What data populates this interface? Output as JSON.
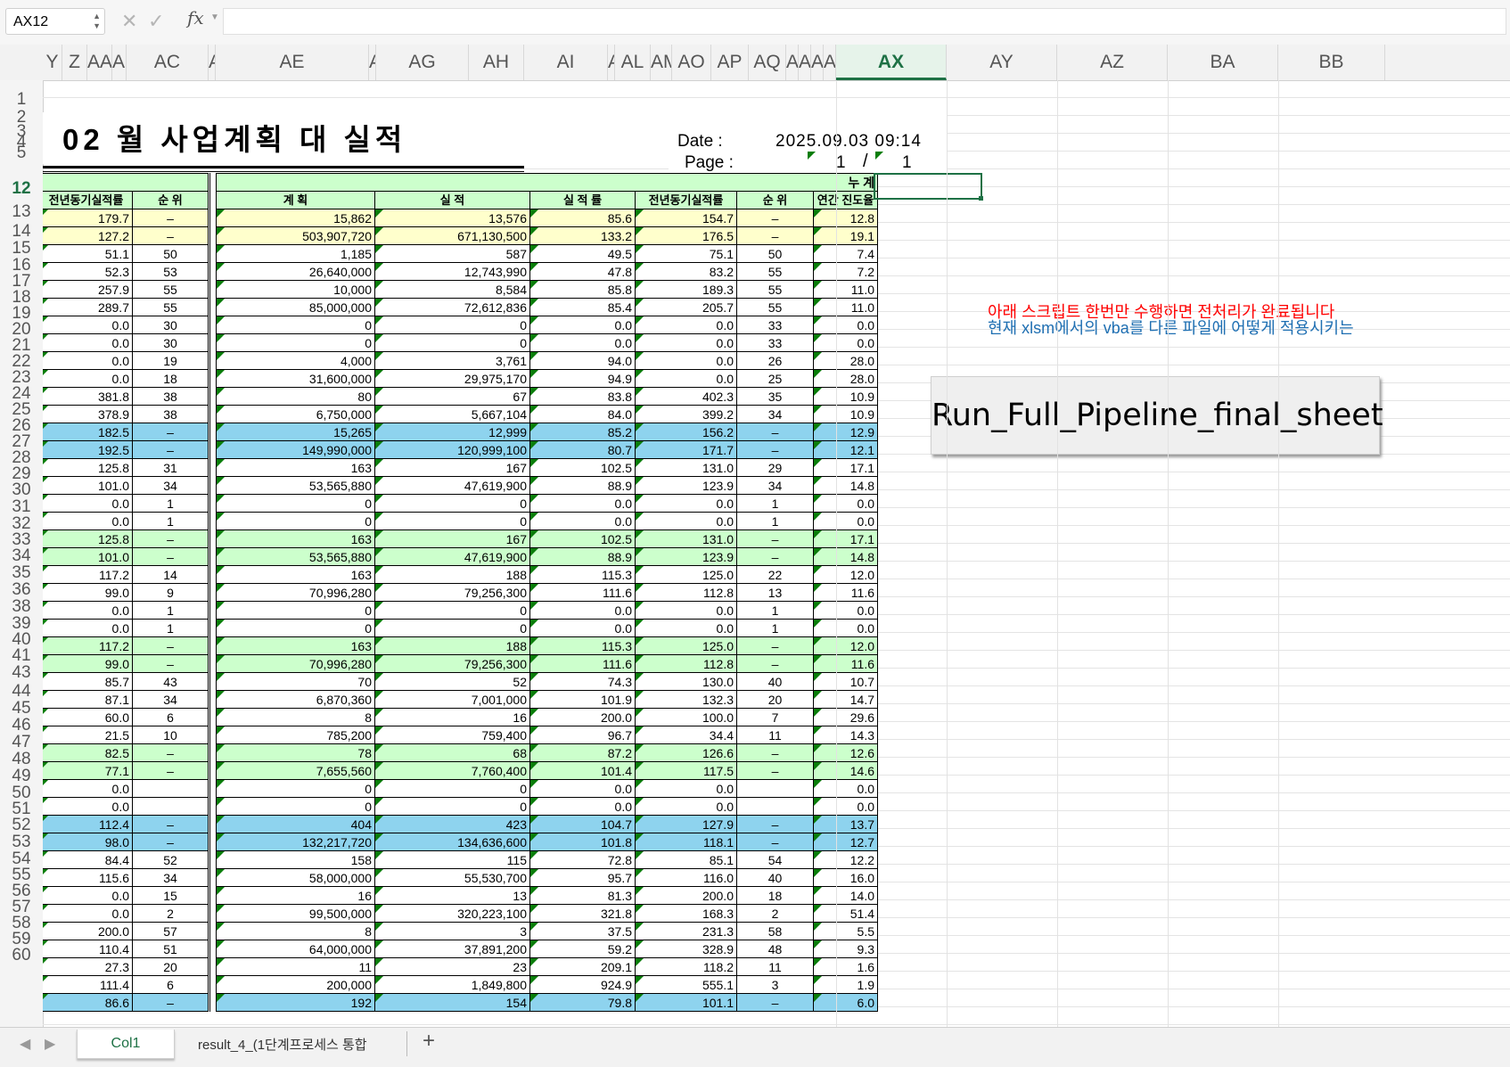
{
  "formula_bar": {
    "name_box": "AX12",
    "fx": "fx",
    "cancel": "✕",
    "confirm": "✓"
  },
  "columns": [
    "Y",
    "Z",
    "AA",
    "AI",
    "AC",
    "A",
    "AE",
    "A",
    "AG",
    "AH",
    "AI",
    "A",
    "AL",
    "AM",
    "AO",
    "AP",
    "AQ",
    "AR",
    "AS",
    "AT",
    "AU",
    "AX",
    "AY",
    "AZ",
    "BA",
    "BB"
  ],
  "selected_column": "AX",
  "rows": [
    "1",
    "2",
    "3",
    "4",
    "5",
    "12",
    "13",
    "14",
    "15",
    "16",
    "17",
    "18",
    "19",
    "20",
    "21",
    "22",
    "23",
    "24",
    "25",
    "26",
    "27",
    "28",
    "29",
    "30",
    "31",
    "32",
    "33",
    "34",
    "35",
    "36",
    "38",
    "39",
    "40",
    "41",
    "43",
    "44",
    "45",
    "46",
    "47",
    "48",
    "49",
    "50",
    "51",
    "52",
    "53",
    "54",
    "55",
    "56",
    "57",
    "58",
    "59",
    "60"
  ],
  "selected_row": "12",
  "sheet": {
    "title": "02 월  사업계획 대 실적",
    "date_label": "Date :",
    "date_value": "2025.09.03 09:14",
    "page_label": "Page :",
    "page_current": "1",
    "page_sep": "/",
    "page_total": "1"
  },
  "table": {
    "group_header": "누        계",
    "headers": [
      "전년동기실적률",
      "순 위",
      "계    획",
      "실    적",
      "실 적 률",
      "전년동기실적률",
      "순 위",
      "연간 진도율"
    ],
    "rows": [
      {
        "s": "y",
        "v": [
          "179.7",
          "–",
          "15,862",
          "13,576",
          "85.6",
          "154.7",
          "–",
          "12.8"
        ]
      },
      {
        "s": "y",
        "v": [
          "127.2",
          "–",
          "503,907,720",
          "671,130,500",
          "133.2",
          "176.5",
          "–",
          "19.1"
        ]
      },
      {
        "s": "",
        "v": [
          "51.1",
          "50",
          "1,185",
          "587",
          "49.5",
          "75.1",
          "50",
          "7.4"
        ]
      },
      {
        "s": "",
        "v": [
          "52.3",
          "53",
          "26,640,000",
          "12,743,990",
          "47.8",
          "83.2",
          "55",
          "7.2"
        ]
      },
      {
        "s": "",
        "v": [
          "257.9",
          "55",
          "10,000",
          "8,584",
          "85.8",
          "189.3",
          "55",
          "11.0"
        ]
      },
      {
        "s": "",
        "v": [
          "289.7",
          "55",
          "85,000,000",
          "72,612,836",
          "85.4",
          "205.7",
          "55",
          "11.0"
        ]
      },
      {
        "s": "",
        "v": [
          "0.0",
          "30",
          "0",
          "0",
          "0.0",
          "0.0",
          "33",
          "0.0"
        ]
      },
      {
        "s": "",
        "v": [
          "0.0",
          "30",
          "0",
          "0",
          "0.0",
          "0.0",
          "33",
          "0.0"
        ]
      },
      {
        "s": "",
        "v": [
          "0.0",
          "19",
          "4,000",
          "3,761",
          "94.0",
          "0.0",
          "26",
          "28.0"
        ]
      },
      {
        "s": "",
        "v": [
          "0.0",
          "18",
          "31,600,000",
          "29,975,170",
          "94.9",
          "0.0",
          "25",
          "28.0"
        ]
      },
      {
        "s": "",
        "v": [
          "381.8",
          "38",
          "80",
          "67",
          "83.8",
          "402.3",
          "35",
          "10.9"
        ]
      },
      {
        "s": "",
        "v": [
          "378.9",
          "38",
          "6,750,000",
          "5,667,104",
          "84.0",
          "399.2",
          "34",
          "10.9"
        ]
      },
      {
        "s": "b",
        "v": [
          "182.5",
          "–",
          "15,265",
          "12,999",
          "85.2",
          "156.2",
          "–",
          "12.9"
        ]
      },
      {
        "s": "b",
        "v": [
          "192.5",
          "–",
          "149,990,000",
          "120,999,100",
          "80.7",
          "171.7",
          "–",
          "12.1"
        ]
      },
      {
        "s": "",
        "v": [
          "125.8",
          "31",
          "163",
          "167",
          "102.5",
          "131.0",
          "29",
          "17.1"
        ]
      },
      {
        "s": "",
        "v": [
          "101.0",
          "34",
          "53,565,880",
          "47,619,900",
          "88.9",
          "123.9",
          "34",
          "14.8"
        ]
      },
      {
        "s": "",
        "v": [
          "0.0",
          "1",
          "0",
          "0",
          "0.0",
          "0.0",
          "1",
          "0.0"
        ]
      },
      {
        "s": "",
        "v": [
          "0.0",
          "1",
          "0",
          "0",
          "0.0",
          "0.0",
          "1",
          "0.0"
        ]
      },
      {
        "s": "g",
        "v": [
          "125.8",
          "–",
          "163",
          "167",
          "102.5",
          "131.0",
          "–",
          "17.1"
        ]
      },
      {
        "s": "g",
        "v": [
          "101.0",
          "–",
          "53,565,880",
          "47,619,900",
          "88.9",
          "123.9",
          "–",
          "14.8"
        ]
      },
      {
        "s": "",
        "v": [
          "117.2",
          "14",
          "163",
          "188",
          "115.3",
          "125.0",
          "22",
          "12.0"
        ]
      },
      {
        "s": "",
        "v": [
          "99.0",
          "9",
          "70,996,280",
          "79,256,300",
          "111.6",
          "112.8",
          "13",
          "11.6"
        ]
      },
      {
        "s": "",
        "v": [
          "0.0",
          "1",
          "0",
          "0",
          "0.0",
          "0.0",
          "1",
          "0.0"
        ]
      },
      {
        "s": "",
        "v": [
          "0.0",
          "1",
          "0",
          "0",
          "0.0",
          "0.0",
          "1",
          "0.0"
        ]
      },
      {
        "s": "g",
        "v": [
          "117.2",
          "–",
          "163",
          "188",
          "115.3",
          "125.0",
          "–",
          "12.0"
        ]
      },
      {
        "s": "g",
        "v": [
          "99.0",
          "–",
          "70,996,280",
          "79,256,300",
          "111.6",
          "112.8",
          "–",
          "11.6"
        ]
      },
      {
        "s": "",
        "v": [
          "85.7",
          "43",
          "70",
          "52",
          "74.3",
          "130.0",
          "40",
          "10.7"
        ]
      },
      {
        "s": "",
        "v": [
          "87.1",
          "34",
          "6,870,360",
          "7,001,000",
          "101.9",
          "132.3",
          "20",
          "14.7"
        ]
      },
      {
        "s": "",
        "v": [
          "60.0",
          "6",
          "8",
          "16",
          "200.0",
          "100.0",
          "7",
          "29.6"
        ]
      },
      {
        "s": "",
        "v": [
          "21.5",
          "10",
          "785,200",
          "759,400",
          "96.7",
          "34.4",
          "11",
          "14.3"
        ]
      },
      {
        "s": "g",
        "v": [
          "82.5",
          "–",
          "78",
          "68",
          "87.2",
          "126.6",
          "–",
          "12.6"
        ]
      },
      {
        "s": "g",
        "v": [
          "77.1",
          "–",
          "7,655,560",
          "7,760,400",
          "101.4",
          "117.5",
          "–",
          "14.6"
        ]
      },
      {
        "s": "",
        "v": [
          "0.0",
          "",
          "0",
          "0",
          "0.0",
          "0.0",
          "",
          "0.0"
        ]
      },
      {
        "s": "",
        "v": [
          "0.0",
          "",
          "0",
          "0",
          "0.0",
          "0.0",
          "",
          "0.0"
        ]
      },
      {
        "s": "b",
        "v": [
          "112.4",
          "–",
          "404",
          "423",
          "104.7",
          "127.9",
          "–",
          "13.7"
        ]
      },
      {
        "s": "b",
        "v": [
          "98.0",
          "–",
          "132,217,720",
          "134,636,600",
          "101.8",
          "118.1",
          "–",
          "12.7"
        ]
      },
      {
        "s": "",
        "v": [
          "84.4",
          "52",
          "158",
          "115",
          "72.8",
          "85.1",
          "54",
          "12.2"
        ]
      },
      {
        "s": "",
        "v": [
          "115.6",
          "34",
          "58,000,000",
          "55,530,700",
          "95.7",
          "116.0",
          "40",
          "16.0"
        ]
      },
      {
        "s": "",
        "v": [
          "0.0",
          "15",
          "16",
          "13",
          "81.3",
          "200.0",
          "18",
          "14.0"
        ]
      },
      {
        "s": "",
        "v": [
          "0.0",
          "2",
          "99,500,000",
          "320,223,100",
          "321.8",
          "168.3",
          "2",
          "51.4"
        ]
      },
      {
        "s": "",
        "v": [
          "200.0",
          "57",
          "8",
          "3",
          "37.5",
          "231.3",
          "58",
          "5.5"
        ]
      },
      {
        "s": "",
        "v": [
          "110.4",
          "51",
          "64,000,000",
          "37,891,200",
          "59.2",
          "328.9",
          "48",
          "9.3"
        ]
      },
      {
        "s": "",
        "v": [
          "27.3",
          "20",
          "11",
          "23",
          "209.1",
          "118.2",
          "11",
          "1.6"
        ]
      },
      {
        "s": "",
        "v": [
          "111.4",
          "6",
          "200,000",
          "1,849,800",
          "924.9",
          "555.1",
          "3",
          "1.9"
        ]
      },
      {
        "s": "b",
        "v": [
          "86.6",
          "–",
          "192",
          "154",
          "79.8",
          "101.1",
          "–",
          "6.0"
        ]
      }
    ]
  },
  "notes": {
    "line1": "아래 스크립트 한번만 수행하면 전처리가 완료됩니다",
    "line2": "현재 xlsm에서의 vba를 다른 파일에 어떻게 적용시키는"
  },
  "macro_button": "Run_Full_Pipeline_final_sheet",
  "tabs": {
    "active": "Col1",
    "other": "result_4_(1단계프로세스 통합",
    "add": "+",
    "prev": "◀",
    "next": "▶"
  },
  "colors": {
    "accent": "#1e7145",
    "yellow": "#ffffcc",
    "blue": "#8ed3ee",
    "green": "#ccffcc",
    "note_red": "#ff0000",
    "note_blue": "#1f6fb2"
  }
}
